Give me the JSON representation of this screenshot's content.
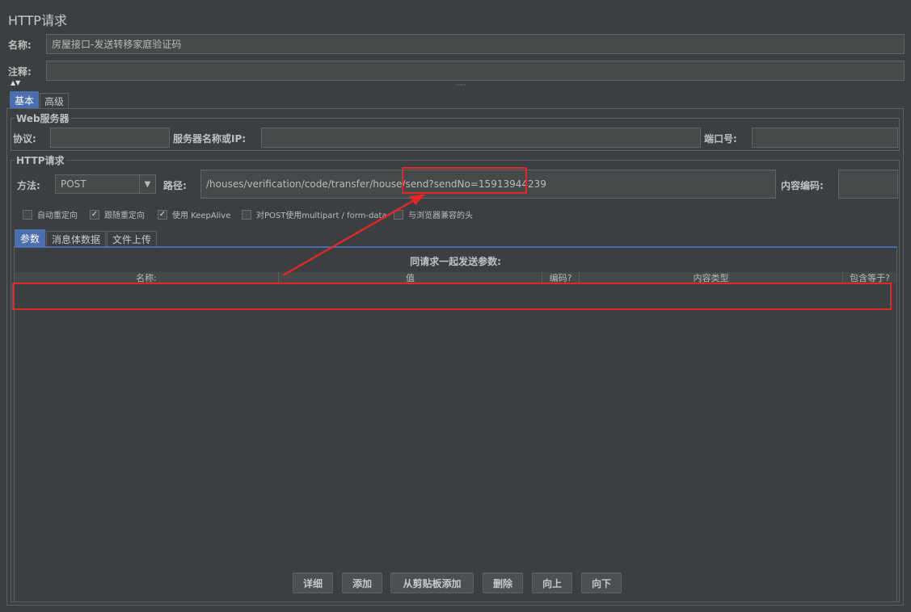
{
  "panel_title": "HTTP请求",
  "name_label": "名称:",
  "name_value": "房屋接口-发送转移家庭验证码",
  "comment_label": "注释:",
  "comment_value": "",
  "tabs": {
    "basic": "基本",
    "advanced": "高级"
  },
  "web_server": {
    "title": "Web服务器",
    "protocol_label": "协议:",
    "protocol_value": "",
    "server_label": "服务器名称或IP:",
    "server_value": "",
    "port_label": "端口号:",
    "port_value": ""
  },
  "http_request": {
    "title": "HTTP请求",
    "method_label": "方法:",
    "method_value": "POST",
    "path_label": "路径:",
    "path_value": "/houses/verification/code/transfer/house/send?sendNo=15913944239",
    "encoding_label": "内容编码:",
    "encoding_value": ""
  },
  "checkboxes": [
    {
      "label": "自动重定向",
      "checked": false
    },
    {
      "label": "跟随重定向",
      "checked": true
    },
    {
      "label": "使用 KeepAlive",
      "checked": true
    },
    {
      "label": "对POST使用multipart / form-data",
      "checked": false
    },
    {
      "label": "与浏览器兼容的头",
      "checked": false
    }
  ],
  "sub_tabs": {
    "params": "参数",
    "body": "消息体数据",
    "files": "文件上传"
  },
  "params_table": {
    "caption": "同请求一起发送参数:",
    "columns": [
      "名称:",
      "值",
      "编码?",
      "内容类型",
      "包含等于?"
    ]
  },
  "buttons": {
    "detail": "详细",
    "add": "添加",
    "add_clipboard": "从剪贴板添加",
    "delete": "删除",
    "up": "向上",
    "down": "向下"
  },
  "colors": {
    "background": "#3c3f41",
    "field": "#45494a",
    "active_tab": "#4b6eaf",
    "annotation_red": "#e02828"
  }
}
